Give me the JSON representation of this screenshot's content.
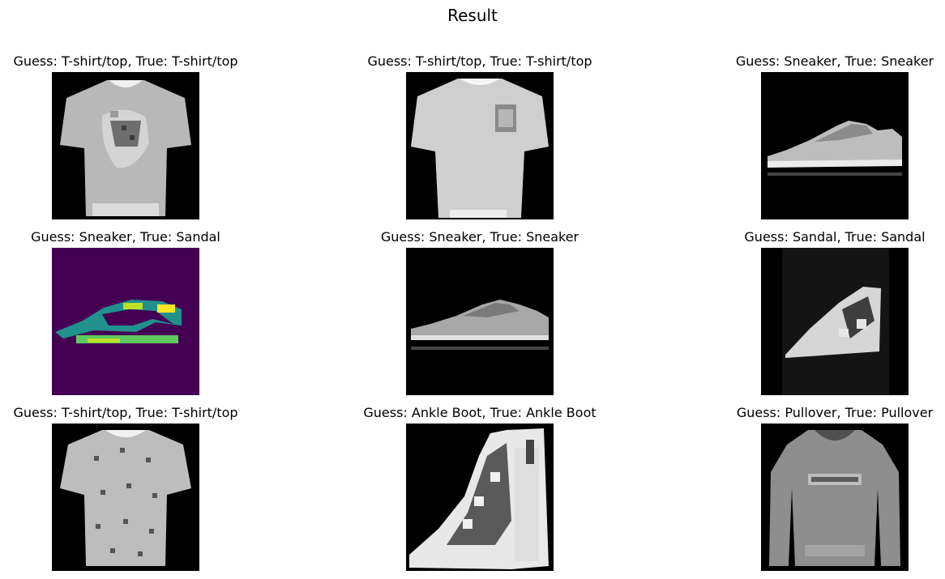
{
  "figure": {
    "title": "Result"
  },
  "panels": [
    {
      "title": "Guess: T-shirt/top, True: T-shirt/top",
      "item": "tshirt-icon",
      "colormap": "gray"
    },
    {
      "title": "Guess: T-shirt/top, True: T-shirt/top",
      "item": "tshirt-icon",
      "colormap": "gray"
    },
    {
      "title": "Guess: Sneaker, True: Sneaker",
      "item": "sneaker-icon",
      "colormap": "gray"
    },
    {
      "title": "Guess: Sneaker, True: Sandal",
      "item": "sandal-icon",
      "colormap": "viridis"
    },
    {
      "title": "Guess: Sneaker, True: Sneaker",
      "item": "sneaker-icon",
      "colormap": "gray"
    },
    {
      "title": "Guess: Sandal, True: Sandal",
      "item": "sandal-icon",
      "colormap": "gray"
    },
    {
      "title": "Guess: T-shirt/top, True: T-shirt/top",
      "item": "tshirt-icon",
      "colormap": "gray"
    },
    {
      "title": "Guess: Ankle Boot, True: Ankle Boot",
      "item": "ankle-boot-icon",
      "colormap": "gray"
    },
    {
      "title": "Guess: Pullover, True: Pullover",
      "item": "pullover-icon",
      "colormap": "gray"
    }
  ]
}
